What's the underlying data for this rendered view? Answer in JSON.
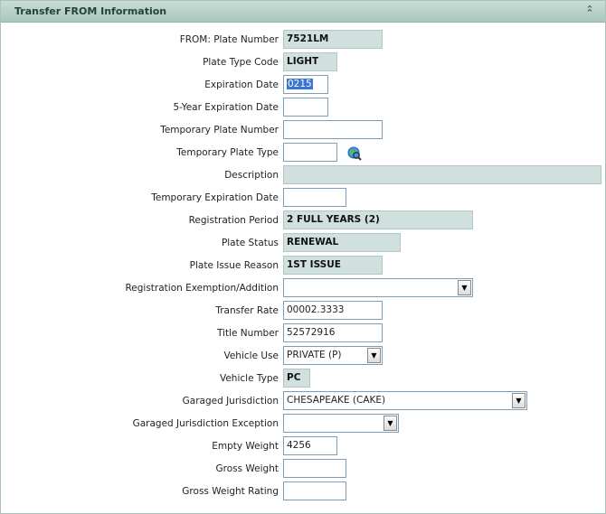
{
  "panel": {
    "title": "Transfer FROM Information",
    "collapse_icon": "double-chevron-up-icon"
  },
  "fields": {
    "plate_number": {
      "label": "FROM:  Plate Number",
      "value": "7521LM"
    },
    "plate_type_code": {
      "label": "Plate Type Code",
      "value": "LIGHT"
    },
    "expiration_date": {
      "label": "Expiration Date",
      "value": "0215"
    },
    "five_year_expiration": {
      "label": "5-Year Expiration Date",
      "value": ""
    },
    "temp_plate_number": {
      "label": "Temporary Plate Number",
      "value": ""
    },
    "temp_plate_type": {
      "label": "Temporary Plate Type",
      "value": "",
      "lookup_icon": "globe-search-icon"
    },
    "description": {
      "label": "Description",
      "value": ""
    },
    "temp_expiration_date": {
      "label": "Temporary Expiration Date",
      "value": ""
    },
    "registration_period": {
      "label": "Registration Period",
      "value": "2 FULL YEARS (2)"
    },
    "plate_status": {
      "label": "Plate Status",
      "value": "RENEWAL"
    },
    "plate_issue_reason": {
      "label": "Plate Issue Reason",
      "value": "1ST ISSUE"
    },
    "registration_exemption": {
      "label": "Registration Exemption/Addition",
      "value": ""
    },
    "transfer_rate": {
      "label": "Transfer Rate",
      "value": "00002.3333"
    },
    "title_number": {
      "label": "Title Number",
      "value": "52572916"
    },
    "vehicle_use": {
      "label": "Vehicle Use",
      "value": "PRIVATE (P)"
    },
    "vehicle_type": {
      "label": "Vehicle Type",
      "value": "PC"
    },
    "garaged_jurisdiction": {
      "label": "Garaged Jurisdiction",
      "value": "CHESAPEAKE (CAKE)"
    },
    "garaged_jurisdiction_exception": {
      "label": "Garaged Jurisdiction Exception",
      "value": ""
    },
    "empty_weight": {
      "label": "Empty Weight",
      "value": "4256"
    },
    "gross_weight": {
      "label": "Gross Weight",
      "value": ""
    },
    "gross_weight_rating": {
      "label": "Gross Weight Rating",
      "value": ""
    }
  },
  "colors": {
    "header_bg": "#b4cec5",
    "readonly_bg": "#cfe0df",
    "selection": "#3875d7"
  }
}
